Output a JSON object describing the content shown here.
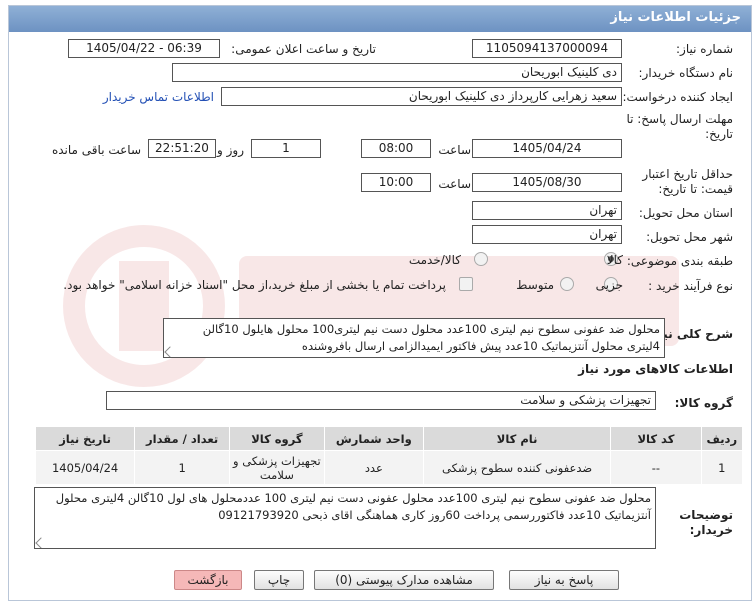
{
  "header": {
    "title": "جزئیات اطلاعات نیاز"
  },
  "form": {
    "need_number_label": "شماره نیاز:",
    "need_number": "1105094137000094",
    "announce_label": "تاریخ و ساعت اعلان عمومی:",
    "announce_value": "1405/04/22 - 06:39",
    "buyer_org_label": "نام دستگاه خریدار:",
    "buyer_org": "دی کلینیک ابوریحان",
    "creator_label": "ایجاد کننده درخواست:",
    "creator": "سعید زهرایی کارپرداز دی کلینیک ابوریحان",
    "contact_link": "اطلاعات تماس خریدار",
    "deadline_label_1": "مهلت ارسال پاسخ: تا",
    "deadline_label_2": "تاریخ:",
    "deadline_date": "1405/04/24",
    "time_label": "ساعت",
    "deadline_time": "08:00",
    "days": "1",
    "days_label": "روز و",
    "remaining_time": "22:51:20",
    "remaining_label": "ساعت باقی مانده",
    "validity_label_1": "حداقل تاریخ اعتبار",
    "validity_label_2": "قیمت: تا تاریخ:",
    "validity_date": "1405/08/30",
    "validity_time": "10:00",
    "province_label": "استان محل تحویل:",
    "province": "تهران",
    "city_label": "شهر محل تحویل:",
    "city": "تهران",
    "category_label": "طبقه بندی موضوعی:",
    "cat_goods": "کالا",
    "cat_service": "کالا/خدمت",
    "process_label": "نوع فرآیند خرید :",
    "proc_partial": "جزیی",
    "proc_medium": "متوسط",
    "payment_note": "پرداخت تمام یا بخشی از مبلغ خرید،از محل \"اسناد خزانه اسلامی\" خواهد بود."
  },
  "summary": {
    "label": "شرح کلی نیاز:",
    "text": "محلول ضد عفونی سطوح نیم لیتری 100عدد محلول  دست نیم لیتری100 محلول هایلول 10گالن 4لیتری محلول آنتزیماتیک 10عدد پیش فاکتور ایمیدالزامی ارسال بافروشنده"
  },
  "goods": {
    "section_title": "اطلاعات کالاهای مورد نیاز",
    "group_label": "گروه کالا:",
    "group_value": "تجهیزات پزشکی و سلامت",
    "columns": [
      "ردیف",
      "کد کالا",
      "نام کالا",
      "واحد شمارش",
      "گروه کالا",
      "تعداد / مقدار",
      "تاریخ نیاز"
    ],
    "rows": [
      [
        "1",
        "--",
        "ضدعفونی کننده سطوح پزشکی",
        "عدد",
        "تجهیزات پزشکی و سلامت",
        "1",
        "1405/04/24"
      ]
    ]
  },
  "buyer_notes": {
    "label_1": "توضیحات",
    "label_2": "خریدار:",
    "text": "محلول ضد عفونی سطوح نیم لیتری 100عدد محلول عفونی دست نیم لیتری 100 عددمحلول های لول 10گالن 4لیتری محلول آنتزیماتیک 10عدد فاکتوررسمی پرداخت 60روز کاری هماهنگی اقای ذبحی 09121793920"
  },
  "buttons": {
    "reply": "پاسخ به نیاز",
    "docs": "مشاهده مدارک پیوستی (0)",
    "print": "چاپ",
    "back": "بازگشت"
  },
  "colors": {
    "title_bg": "#7a9dc9",
    "back_button": "#f5b8b8",
    "link": "#2350b5"
  }
}
